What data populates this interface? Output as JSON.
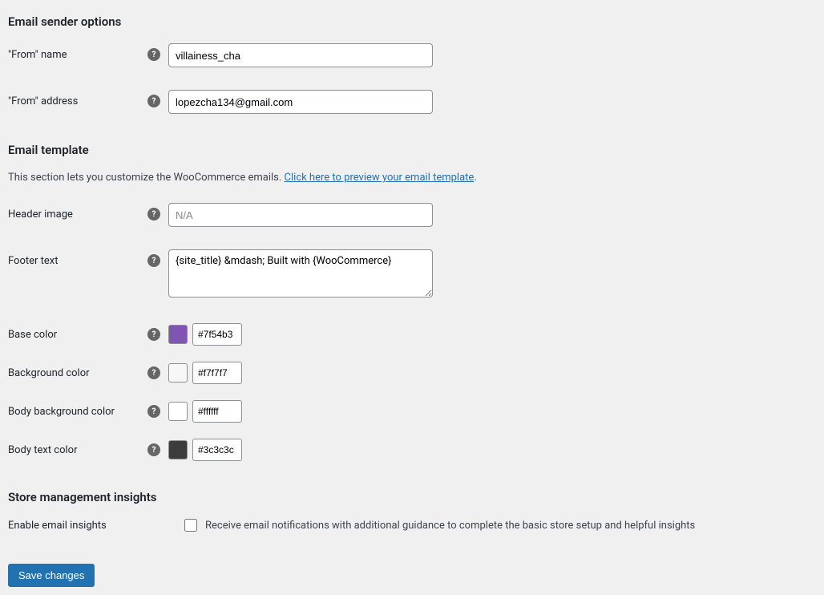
{
  "sections": {
    "sender": {
      "heading": "Email sender options",
      "from_name": {
        "label": "\"From\" name",
        "value": "villainess_cha"
      },
      "from_address": {
        "label": "\"From\" address",
        "value": "lopezcha134@gmail.com"
      }
    },
    "template": {
      "heading": "Email template",
      "description_prefix": "This section lets you customize the WooCommerce emails. ",
      "description_link": "Click here to preview your email template",
      "description_suffix": ".",
      "header_image": {
        "label": "Header image",
        "placeholder": "N/A",
        "value": ""
      },
      "footer_text": {
        "label": "Footer text",
        "value": "{site_title} &mdash; Built with {WooCommerce}"
      },
      "base_color": {
        "label": "Base color",
        "value": "#7f54b3",
        "swatch": "#7f54b3"
      },
      "background_color": {
        "label": "Background color",
        "value": "#f7f7f7",
        "swatch": "#f7f7f7"
      },
      "body_background_color": {
        "label": "Body background color",
        "value": "#ffffff",
        "swatch": "#ffffff"
      },
      "body_text_color": {
        "label": "Body text color",
        "value": "#3c3c3c",
        "swatch": "#3c3c3c"
      }
    },
    "insights": {
      "heading": "Store management insights",
      "enable": {
        "label": "Enable email insights",
        "description": "Receive email notifications with additional guidance to complete the basic store setup and helpful insights",
        "checked": false
      }
    }
  },
  "save_button": "Save changes",
  "help_glyph": "?"
}
